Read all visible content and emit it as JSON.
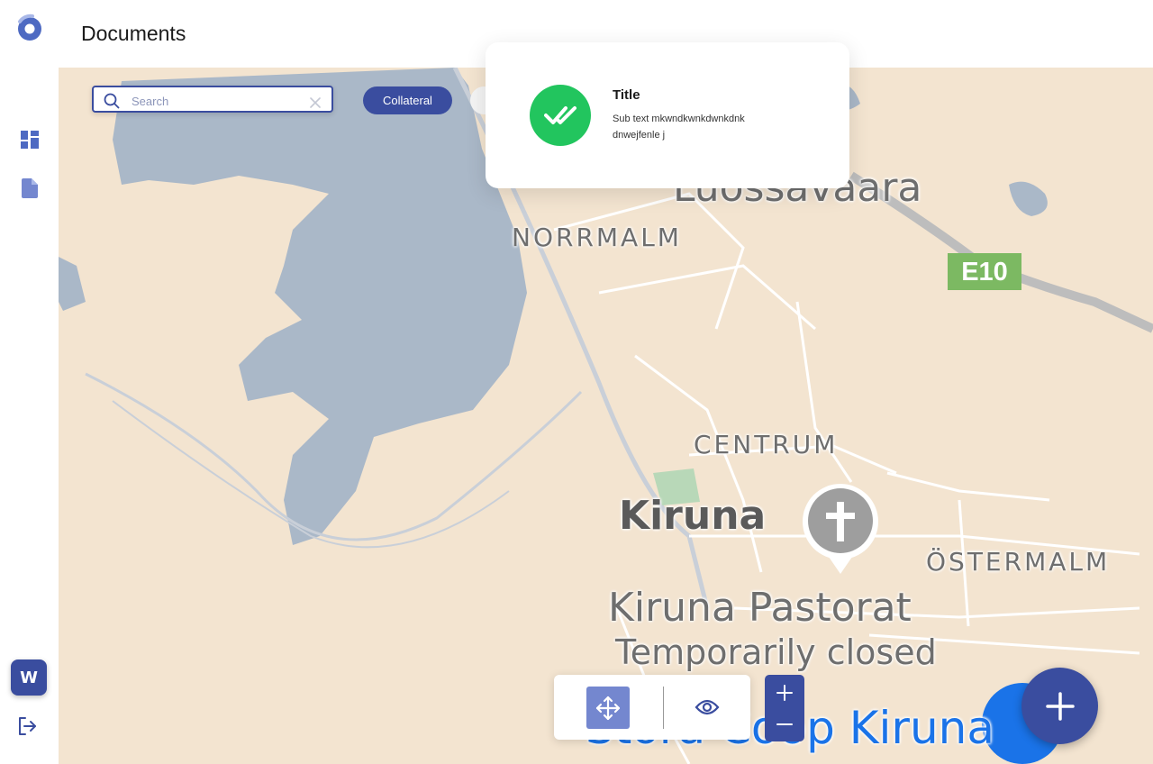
{
  "header": {
    "title": "Documents"
  },
  "sidebar": {
    "items": [
      {
        "icon": "dashboard-icon"
      },
      {
        "icon": "document-icon"
      }
    ],
    "avatar_initial": "W",
    "logout_icon": "logout-icon"
  },
  "search": {
    "placeholder": "Search",
    "value": ""
  },
  "filters": {
    "chips": [
      {
        "label": "Collateral",
        "active": true
      }
    ]
  },
  "toast": {
    "title": "Title",
    "subtext": "Sub text mkwndkwnkdwnkdnk dnwejfenle j"
  },
  "map": {
    "labels": {
      "luossavaara": "Luossavaara",
      "norrmalm": "NORRMALM",
      "e10": "E10",
      "centrum": "CENTRUM",
      "kiruna": "Kiruna",
      "ostermalm": "ÖSTERMALM",
      "pastorat": "Kiruna Pastorat",
      "closed": "Temporarily closed",
      "coop": "Stora Coop Kiruna"
    }
  },
  "colors": {
    "accent": "#3a4d9f",
    "accent_light": "#7487cf",
    "success": "#22c55e",
    "map_land": "#f3e4d0",
    "map_water": "#aab8c8",
    "highway": "#7cb962"
  }
}
